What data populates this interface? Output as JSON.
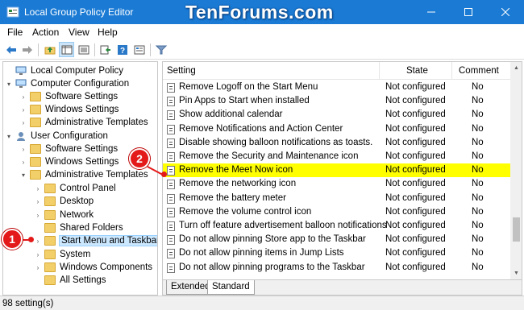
{
  "window": {
    "title": "Local Group Policy Editor",
    "watermark": "TenForums.com"
  },
  "menu": [
    "File",
    "Action",
    "View",
    "Help"
  ],
  "tree": [
    {
      "label": "Local Computer Policy",
      "expander": "",
      "icon": "computer-icon"
    },
    {
      "label": "Computer Configuration",
      "expander": "▾",
      "icon": "computer-icon"
    },
    {
      "label": "Software Settings",
      "expander": "›",
      "icon": "folder-icon"
    },
    {
      "label": "Windows Settings",
      "expander": "›",
      "icon": "folder-icon"
    },
    {
      "label": "Administrative Templates",
      "expander": "›",
      "icon": "folder-icon"
    },
    {
      "label": "User Configuration",
      "expander": "▾",
      "icon": "user-icon"
    },
    {
      "label": "Software Settings",
      "expander": "›",
      "icon": "folder-icon"
    },
    {
      "label": "Windows Settings",
      "expander": "›",
      "icon": "folder-icon"
    },
    {
      "label": "Administrative Templates",
      "expander": "▾",
      "icon": "folder-icon"
    },
    {
      "label": "Control Panel",
      "expander": "›",
      "icon": "folder-icon"
    },
    {
      "label": "Desktop",
      "expander": "›",
      "icon": "folder-icon"
    },
    {
      "label": "Network",
      "expander": "›",
      "icon": "folder-icon"
    },
    {
      "label": "Shared Folders",
      "expander": "",
      "icon": "folder-icon"
    },
    {
      "label": "Start Menu and Taskbar",
      "expander": "›",
      "icon": "folder-icon",
      "selected": true
    },
    {
      "label": "System",
      "expander": "›",
      "icon": "folder-icon"
    },
    {
      "label": "Windows Components",
      "expander": "›",
      "icon": "folder-icon"
    },
    {
      "label": "All Settings",
      "expander": "",
      "icon": "folder-icon"
    }
  ],
  "list": {
    "columns": {
      "setting": "Setting",
      "state": "State",
      "comment": "Comment"
    },
    "rows": [
      {
        "setting": "Remove Logoff on the Start Menu",
        "state": "Not configured",
        "comment": "No"
      },
      {
        "setting": "Pin Apps to Start when installed",
        "state": "Not configured",
        "comment": "No"
      },
      {
        "setting": "Show additional calendar",
        "state": "Not configured",
        "comment": "No"
      },
      {
        "setting": "Remove Notifications and Action Center",
        "state": "Not configured",
        "comment": "No"
      },
      {
        "setting": "Disable showing balloon notifications as toasts.",
        "state": "Not configured",
        "comment": "No"
      },
      {
        "setting": "Remove the Security and Maintenance icon",
        "state": "Not configured",
        "comment": "No"
      },
      {
        "setting": "Remove the Meet Now icon",
        "state": "Not configured",
        "comment": "No",
        "highlighted": true
      },
      {
        "setting": "Remove the networking icon",
        "state": "Not configured",
        "comment": "No"
      },
      {
        "setting": "Remove the battery meter",
        "state": "Not configured",
        "comment": "No"
      },
      {
        "setting": "Remove the volume control icon",
        "state": "Not configured",
        "comment": "No"
      },
      {
        "setting": "Turn off feature advertisement balloon notifications",
        "state": "Not configured",
        "comment": "No"
      },
      {
        "setting": "Do not allow pinning Store app to the Taskbar",
        "state": "Not configured",
        "comment": "No"
      },
      {
        "setting": "Do not allow pinning items in Jump Lists",
        "state": "Not configured",
        "comment": "No"
      },
      {
        "setting": "Do not allow pinning programs to the Taskbar",
        "state": "Not configured",
        "comment": "No"
      }
    ]
  },
  "tabs": [
    "Extended",
    "Standard"
  ],
  "status": "98 setting(s)",
  "callouts": [
    "1",
    "2"
  ],
  "colors": {
    "titlebar": "#1a7ad4",
    "highlight": "#ffff00",
    "callout": "#e41a1a"
  }
}
